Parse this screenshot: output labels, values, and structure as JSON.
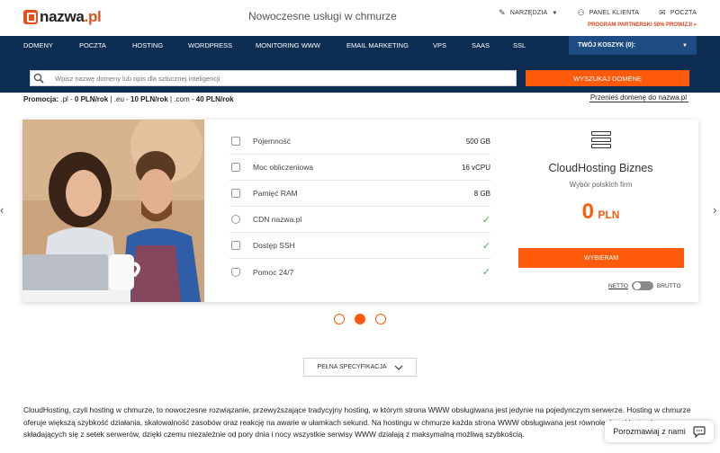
{
  "header": {
    "logo_text": "nazwa",
    "logo_suffix": ".pl",
    "tagline": "Nowoczesne usługi w chmurze",
    "tools": [
      {
        "label": "NARZĘDZIA",
        "icon": "wrench-icon"
      },
      {
        "label": "PANEL KLIENTA",
        "icon": "user-icon"
      },
      {
        "label": "POCZTA",
        "icon": "mail-icon"
      }
    ],
    "partner_text": "PROGRAM PARTNERSKI 50% PROWIZJI »"
  },
  "nav": {
    "items": [
      "DOMENY",
      "POCZTA",
      "HOSTING",
      "WORDPRESS",
      "MONITORING WWW",
      "EMAIL MARKETING",
      "VPS",
      "SaaS",
      "SSL"
    ],
    "cart_label": "TWÓJ KOSZYK (0):"
  },
  "search": {
    "placeholder": "Wpisz nazwę domeny lub opis dla sztucznej inteligencji",
    "button": "WYSZUKAJ DOMENĘ"
  },
  "promo": {
    "label": "Promocja:",
    "text_1": " .pl - ",
    "price_pl": "0 PLN/rok",
    "text_2": " | .eu - ",
    "price_eu": "10 PLN/rok",
    "text_3": " | .com - ",
    "price_com": "40 PLN/rok",
    "transfer_link": "Przenieś domenę do nazwa.pl"
  },
  "card": {
    "specs": [
      {
        "label": "Pojemność",
        "value": "500 GB",
        "icon": "storage-icon"
      },
      {
        "label": "Moc obliczeniowa",
        "value": "16 vCPU",
        "icon": "cpu-icon"
      },
      {
        "label": "Pamięć RAM",
        "value": "8 GB",
        "icon": "ram-icon"
      },
      {
        "label": "CDN nazwa.pl",
        "value": "✓",
        "icon": "cdn-icon"
      },
      {
        "label": "Dostęp SSH",
        "value": "✓",
        "icon": "ssh-icon"
      },
      {
        "label": "Pomoc 24/7",
        "value": "✓",
        "icon": "support-icon"
      }
    ],
    "offer_title": "CloudHosting Biznes",
    "offer_sub": "Wybór polskich firm",
    "price": "0",
    "currency": "PLN",
    "choose_button": "WYBIERAM",
    "netto_label": "NETTO",
    "brutto_label": "BRUTTO"
  },
  "carousel": {
    "active_index": 1,
    "count": 3
  },
  "spec_button": "PEŁNA SPECYFIKACJA",
  "description": "CloudHosting, czyli hosting w chmurze, to nowoczesne rozwiązanie, przewyższające tradycyjny hosting, w którym strona WWW obsługiwana jest jedynie na pojedynczym serwerze. Hosting w chmurze oferuje większą szybkość działania, skalowalność zasobów oraz reakcję na awarie w ułamkach sekund. Na hostingu w chmurze każda strona WWW obsługiwana jest równolegle w klastrach składających się z setek serwerów, dzięki czemu niezależnie od pory dnia i nocy wszystkie serwisy WWW działają z maksymalną możliwą szybkością.",
  "chat_label": "Porozmawiaj z nami",
  "colors": {
    "accent": "#ff5b0a",
    "navy": "#0d2d52"
  }
}
